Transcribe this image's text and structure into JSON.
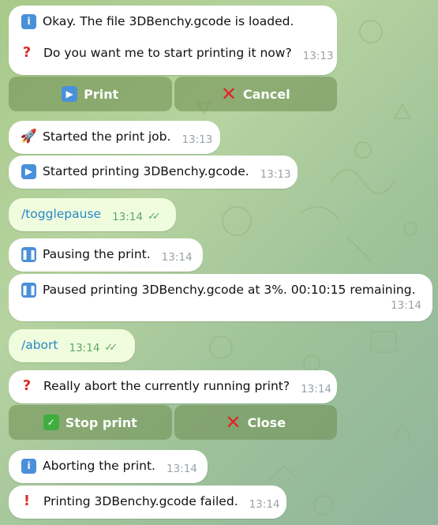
{
  "colors": {
    "incoming_bubble": "#ffffff",
    "outgoing_bubble": "#effdde",
    "command_text": "#2a88c5",
    "button_background": "#6c8c4e",
    "wallpaper": "#a9c98a"
  },
  "messages": [
    {
      "icon": "info-icon",
      "lines": [
        "Okay. The file 3DBenchy.gcode is loaded.",
        "Do you want me to start printing it now?"
      ],
      "time": "13:13"
    },
    {
      "icon": "rocket-icon",
      "text": "Started the print job.",
      "time": "13:13"
    },
    {
      "icon": "play-icon",
      "text": "Started printing 3DBenchy.gcode.",
      "time": "13:13"
    },
    {
      "text": "/togglepause",
      "time": "13:14",
      "direction": "outgoing",
      "status": "read"
    },
    {
      "icon": "pause-icon",
      "text": "Pausing the print.",
      "time": "13:14"
    },
    {
      "icon": "pause-icon",
      "text": "Paused printing 3DBenchy.gcode at 3%. 00:10:15 remaining.",
      "time": "13:14"
    },
    {
      "text": "/abort",
      "time": "13:14",
      "direction": "outgoing",
      "status": "read"
    },
    {
      "icon": "question-icon",
      "text": "Really abort the currently running print?",
      "time": "13:14"
    },
    {
      "icon": "info-icon",
      "text": "Aborting the print.",
      "time": "13:14"
    },
    {
      "icon": "exclamation-icon",
      "text": "Printing 3DBenchy.gcode failed.",
      "time": "13:14"
    }
  ],
  "keyboards": {
    "print_prompt": {
      "print_label": "Print",
      "cancel_label": "Cancel"
    },
    "abort_prompt": {
      "stop_label": "Stop print",
      "close_label": "Close"
    }
  }
}
